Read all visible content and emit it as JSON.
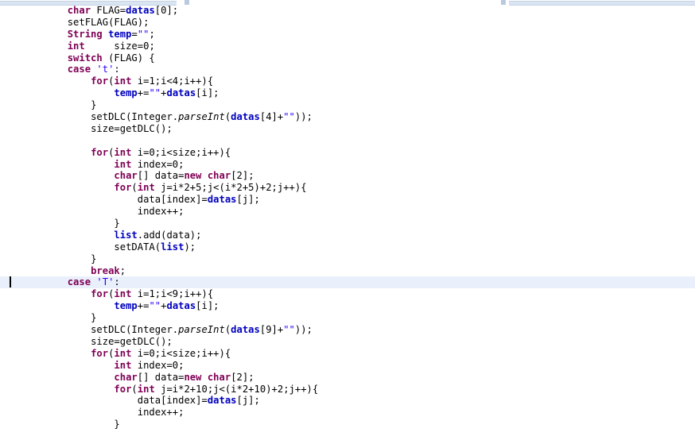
{
  "app": {
    "kind": "code-editor",
    "language": "Java",
    "background": "#ffffff",
    "current_line_highlight_color": "#eaf0fb",
    "caret_visible": true,
    "caret_line_index": 23
  },
  "theme": {
    "keyword_color": "#7f0055",
    "field_color": "#0000c0",
    "string_color": "#2a00ff",
    "plain_color": "#000000",
    "static_method_style": "italic"
  },
  "code": {
    "indent_unit": "    ",
    "lines": [
      {
        "indent": 2,
        "highlight": false,
        "tokens": [
          {
            "t": "char",
            "c": "kw"
          },
          {
            "t": " ",
            "c": "pln"
          },
          {
            "t": "FLAG",
            "c": "pln"
          },
          {
            "t": "=",
            "c": "pln"
          },
          {
            "t": "datas",
            "c": "fld"
          },
          {
            "t": "[0];",
            "c": "pln"
          }
        ]
      },
      {
        "indent": 2,
        "highlight": false,
        "tokens": [
          {
            "t": "setFLAG(FLAG);",
            "c": "pln"
          }
        ]
      },
      {
        "indent": 2,
        "highlight": false,
        "tokens": [
          {
            "t": "String",
            "c": "kw"
          },
          {
            "t": " ",
            "c": "pln"
          },
          {
            "t": "temp",
            "c": "fld"
          },
          {
            "t": "=",
            "c": "pln"
          },
          {
            "t": "\"\"",
            "c": "str"
          },
          {
            "t": ";",
            "c": "pln"
          }
        ]
      },
      {
        "indent": 2,
        "highlight": false,
        "tokens": [
          {
            "t": "int",
            "c": "kw"
          },
          {
            "t": "     ",
            "c": "pln"
          },
          {
            "t": "size",
            "c": "pln"
          },
          {
            "t": "=0;",
            "c": "pln"
          }
        ]
      },
      {
        "indent": 2,
        "highlight": false,
        "tokens": [
          {
            "t": "switch",
            "c": "kw"
          },
          {
            "t": " (FLAG) {",
            "c": "pln"
          }
        ]
      },
      {
        "indent": 2,
        "highlight": false,
        "tokens": [
          {
            "t": "case",
            "c": "kw"
          },
          {
            "t": " ",
            "c": "pln"
          },
          {
            "t": "'t'",
            "c": "chr"
          },
          {
            "t": ":",
            "c": "pln"
          }
        ]
      },
      {
        "indent": 3,
        "highlight": false,
        "tokens": [
          {
            "t": "for",
            "c": "kw"
          },
          {
            "t": "(",
            "c": "pln"
          },
          {
            "t": "int",
            "c": "kw"
          },
          {
            "t": " i=1;i<4;i++){",
            "c": "pln"
          }
        ]
      },
      {
        "indent": 4,
        "highlight": false,
        "tokens": [
          {
            "t": "temp",
            "c": "fld"
          },
          {
            "t": "+=",
            "c": "pln"
          },
          {
            "t": "\"\"",
            "c": "str"
          },
          {
            "t": "+",
            "c": "pln"
          },
          {
            "t": "datas",
            "c": "fld"
          },
          {
            "t": "[i];",
            "c": "pln"
          }
        ]
      },
      {
        "indent": 3,
        "highlight": false,
        "tokens": [
          {
            "t": "}",
            "c": "pln"
          }
        ]
      },
      {
        "indent": 3,
        "highlight": false,
        "tokens": [
          {
            "t": "setDLC(Integer.",
            "c": "pln"
          },
          {
            "t": "parseInt",
            "c": "sta"
          },
          {
            "t": "(",
            "c": "pln"
          },
          {
            "t": "datas",
            "c": "fld"
          },
          {
            "t": "[4]+",
            "c": "pln"
          },
          {
            "t": "\"\"",
            "c": "str"
          },
          {
            "t": "));",
            "c": "pln"
          }
        ]
      },
      {
        "indent": 3,
        "highlight": false,
        "tokens": [
          {
            "t": "size=getDLC();",
            "c": "pln"
          }
        ]
      },
      {
        "indent": 0,
        "highlight": false,
        "tokens": []
      },
      {
        "indent": 3,
        "highlight": false,
        "tokens": [
          {
            "t": "for",
            "c": "kw"
          },
          {
            "t": "(",
            "c": "pln"
          },
          {
            "t": "int",
            "c": "kw"
          },
          {
            "t": " i=0;i<size;i++){",
            "c": "pln"
          }
        ]
      },
      {
        "indent": 4,
        "highlight": false,
        "tokens": [
          {
            "t": "int",
            "c": "kw"
          },
          {
            "t": " index=0;",
            "c": "pln"
          }
        ]
      },
      {
        "indent": 4,
        "highlight": false,
        "tokens": [
          {
            "t": "char",
            "c": "kw"
          },
          {
            "t": "[] data=",
            "c": "pln"
          },
          {
            "t": "new",
            "c": "kw"
          },
          {
            "t": " ",
            "c": "pln"
          },
          {
            "t": "char",
            "c": "kw"
          },
          {
            "t": "[2];",
            "c": "pln"
          }
        ]
      },
      {
        "indent": 4,
        "highlight": false,
        "tokens": [
          {
            "t": "for",
            "c": "kw"
          },
          {
            "t": "(",
            "c": "pln"
          },
          {
            "t": "int",
            "c": "kw"
          },
          {
            "t": " j=i*2+5;j<(i*2+5)+2;j++){",
            "c": "pln"
          }
        ]
      },
      {
        "indent": 5,
        "highlight": false,
        "tokens": [
          {
            "t": "data[index]=",
            "c": "pln"
          },
          {
            "t": "datas",
            "c": "fld"
          },
          {
            "t": "[j];",
            "c": "pln"
          }
        ]
      },
      {
        "indent": 5,
        "highlight": false,
        "tokens": [
          {
            "t": "index++;",
            "c": "pln"
          }
        ]
      },
      {
        "indent": 4,
        "highlight": false,
        "tokens": [
          {
            "t": "}",
            "c": "pln"
          }
        ]
      },
      {
        "indent": 4,
        "highlight": false,
        "tokens": [
          {
            "t": "list",
            "c": "fld"
          },
          {
            "t": ".add(data);",
            "c": "pln"
          }
        ]
      },
      {
        "indent": 4,
        "highlight": false,
        "tokens": [
          {
            "t": "setDATA(",
            "c": "pln"
          },
          {
            "t": "list",
            "c": "fld"
          },
          {
            "t": ");",
            "c": "pln"
          }
        ]
      },
      {
        "indent": 3,
        "highlight": false,
        "tokens": [
          {
            "t": "}",
            "c": "pln"
          }
        ]
      },
      {
        "indent": 3,
        "highlight": false,
        "tokens": [
          {
            "t": "break",
            "c": "kw"
          },
          {
            "t": ";",
            "c": "pln"
          }
        ]
      },
      {
        "indent": 2,
        "highlight": true,
        "tokens": [
          {
            "t": "case",
            "c": "kw"
          },
          {
            "t": " ",
            "c": "pln"
          },
          {
            "t": "'T'",
            "c": "chr"
          },
          {
            "t": ":",
            "c": "pln"
          }
        ]
      },
      {
        "indent": 3,
        "highlight": false,
        "tokens": [
          {
            "t": "for",
            "c": "kw"
          },
          {
            "t": "(",
            "c": "pln"
          },
          {
            "t": "int",
            "c": "kw"
          },
          {
            "t": " i=1;i<9;i++){",
            "c": "pln"
          }
        ]
      },
      {
        "indent": 4,
        "highlight": false,
        "tokens": [
          {
            "t": "temp",
            "c": "fld"
          },
          {
            "t": "+=",
            "c": "pln"
          },
          {
            "t": "\"\"",
            "c": "str"
          },
          {
            "t": "+",
            "c": "pln"
          },
          {
            "t": "datas",
            "c": "fld"
          },
          {
            "t": "[i];",
            "c": "pln"
          }
        ]
      },
      {
        "indent": 3,
        "highlight": false,
        "tokens": [
          {
            "t": "}",
            "c": "pln"
          }
        ]
      },
      {
        "indent": 3,
        "highlight": false,
        "tokens": [
          {
            "t": "setDLC(Integer.",
            "c": "pln"
          },
          {
            "t": "parseInt",
            "c": "sta"
          },
          {
            "t": "(",
            "c": "pln"
          },
          {
            "t": "datas",
            "c": "fld"
          },
          {
            "t": "[9]+",
            "c": "pln"
          },
          {
            "t": "\"\"",
            "c": "str"
          },
          {
            "t": "));",
            "c": "pln"
          }
        ]
      },
      {
        "indent": 3,
        "highlight": false,
        "tokens": [
          {
            "t": "size=getDLC();",
            "c": "pln"
          }
        ]
      },
      {
        "indent": 3,
        "highlight": false,
        "tokens": [
          {
            "t": "for",
            "c": "kw"
          },
          {
            "t": "(",
            "c": "pln"
          },
          {
            "t": "int",
            "c": "kw"
          },
          {
            "t": " i=0;i<size;i++){",
            "c": "pln"
          }
        ]
      },
      {
        "indent": 4,
        "highlight": false,
        "tokens": [
          {
            "t": "int",
            "c": "kw"
          },
          {
            "t": " index=0;",
            "c": "pln"
          }
        ]
      },
      {
        "indent": 4,
        "highlight": false,
        "tokens": [
          {
            "t": "char",
            "c": "kw"
          },
          {
            "t": "[] data=",
            "c": "pln"
          },
          {
            "t": "new",
            "c": "kw"
          },
          {
            "t": " ",
            "c": "pln"
          },
          {
            "t": "char",
            "c": "kw"
          },
          {
            "t": "[2];",
            "c": "pln"
          }
        ]
      },
      {
        "indent": 4,
        "highlight": false,
        "tokens": [
          {
            "t": "for",
            "c": "kw"
          },
          {
            "t": "(",
            "c": "pln"
          },
          {
            "t": "int",
            "c": "kw"
          },
          {
            "t": " j=i*2+10;j<(i*2+10)+2;j++){",
            "c": "pln"
          }
        ]
      },
      {
        "indent": 5,
        "highlight": false,
        "tokens": [
          {
            "t": "data[index]=",
            "c": "pln"
          },
          {
            "t": "datas",
            "c": "fld"
          },
          {
            "t": "[j];",
            "c": "pln"
          }
        ]
      },
      {
        "indent": 5,
        "highlight": false,
        "tokens": [
          {
            "t": "index++;",
            "c": "pln"
          }
        ]
      },
      {
        "indent": 4,
        "highlight": false,
        "tokens": [
          {
            "t": "}",
            "c": "pln"
          }
        ]
      }
    ]
  }
}
